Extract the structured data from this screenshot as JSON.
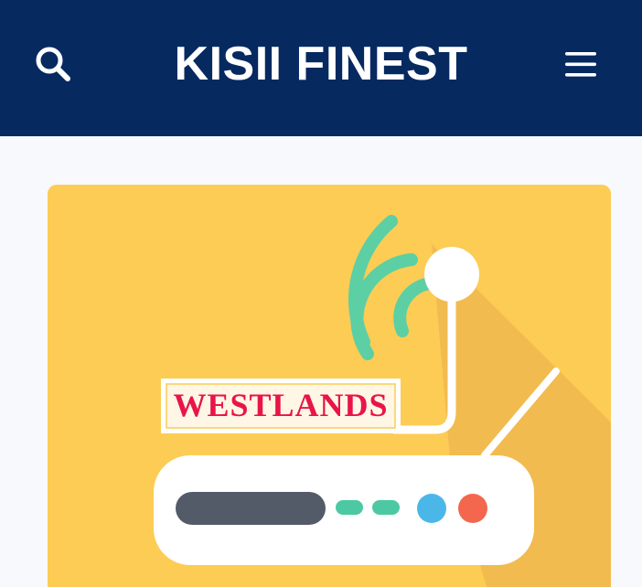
{
  "header": {
    "site_title": "KISII FINEST",
    "search_icon": "search-icon",
    "menu_icon": "hamburger-menu-icon",
    "background": "#062960"
  },
  "article": {
    "thumbnail": {
      "label": "WESTLANDS",
      "icon": "wifi-router-illustration",
      "background": "#fccc55",
      "label_color": "#e8144a"
    }
  }
}
